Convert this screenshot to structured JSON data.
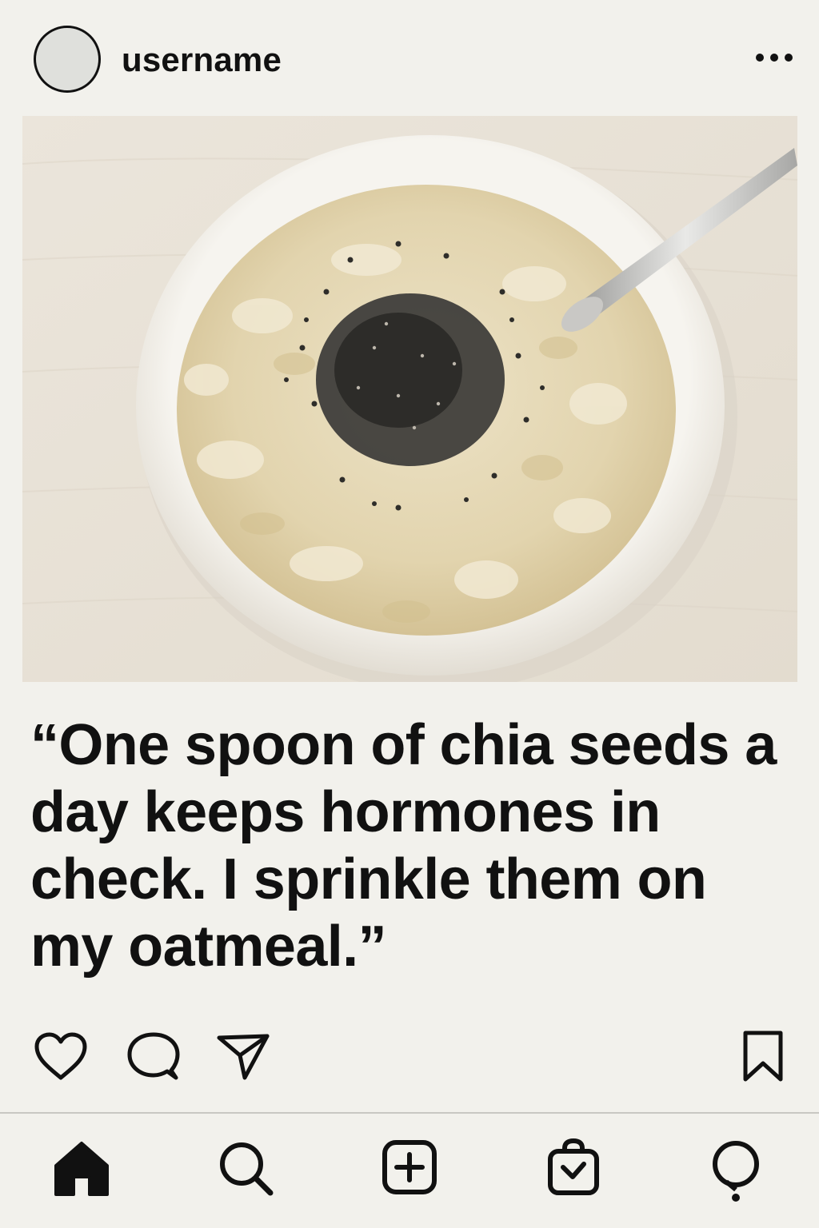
{
  "post": {
    "username": "username",
    "caption": "“One spoon of chia seeds a day keeps hormones in check. I sprinkle them on my oatmeal.”"
  },
  "icons": {
    "more": "more-horizontal-icon",
    "like": "heart-icon",
    "comment": "comment-icon",
    "share": "send-icon",
    "save": "bookmark-icon"
  },
  "nav": {
    "items": [
      "home-icon",
      "search-icon",
      "create-icon",
      "shop-icon",
      "activity-icon"
    ],
    "active": "home-icon"
  },
  "colors": {
    "background": "#f2f1ec",
    "text": "#111111",
    "divider": "#c9c8c2"
  }
}
